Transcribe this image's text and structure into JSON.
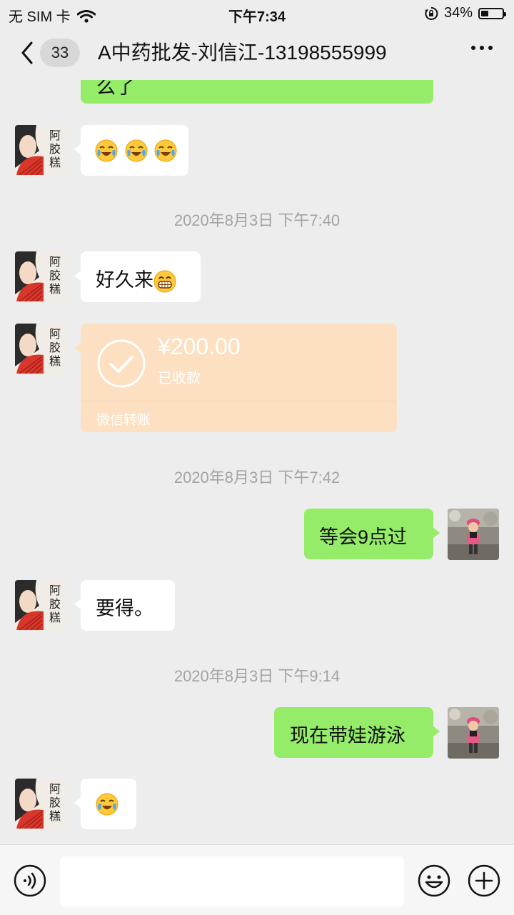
{
  "status_bar": {
    "carrier": "无 SIM 卡",
    "time": "下午7:34",
    "battery": "34%",
    "battery_level": 0.34
  },
  "header": {
    "unread_count": "33",
    "title": "A中药批发-刘信江-13198555999"
  },
  "messages": {
    "partial_top_text": "么了",
    "m1_emojis": [
      "laughing-crying-emoji",
      "laughing-crying-emoji",
      "laughing-crying-emoji"
    ],
    "ts1": "2020年8月3日 下午7:40",
    "m2_text": "好久来",
    "m2_emoji": "grin-emoji",
    "transfer": {
      "amount": "¥200.00",
      "status": "已收款",
      "label": "微信转账"
    },
    "ts2": "2020年8月3日 下午7:42",
    "m4_text": "等会9点过",
    "m5_text": "要得。",
    "ts3": "2020年8月3日 下午9:14",
    "m6_text": "现在带娃游泳",
    "m7_emoji": "laughing-crying-emoji"
  },
  "avatar_text": {
    "chars": [
      "阿",
      "胶",
      "糕"
    ]
  },
  "colors": {
    "outgoing_bubble": "#95ec69",
    "incoming_bubble": "#ffffff",
    "transfer": "#fde0c2",
    "background": "#ededed"
  },
  "input_bar": {
    "left_icon": "voice-icon",
    "right_icons": [
      "emoji-icon",
      "plus-icon"
    ]
  }
}
